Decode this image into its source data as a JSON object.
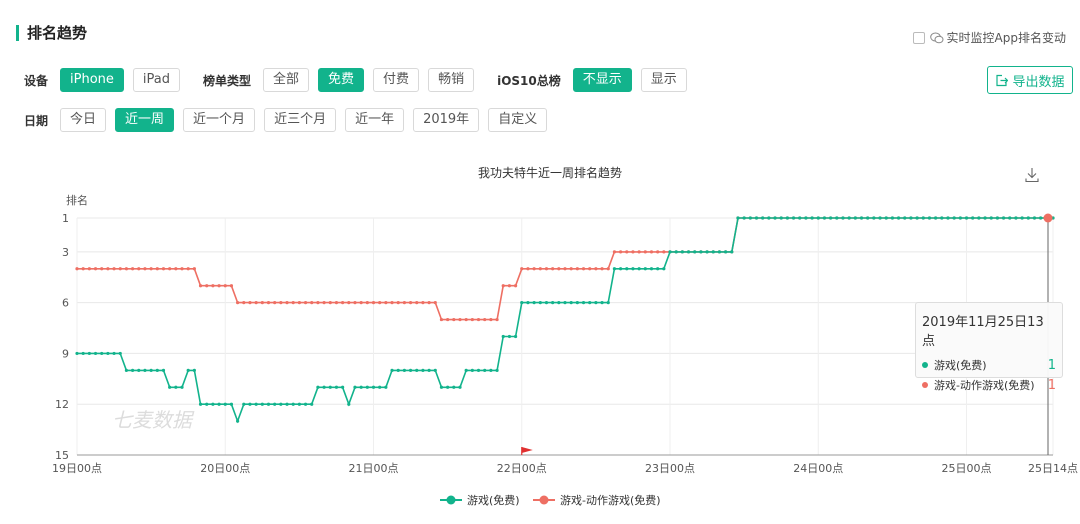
{
  "header": {
    "title": "排名趋势",
    "monitor_label": "实时监控App排名变动",
    "export_label": "导出数据"
  },
  "filters": {
    "device": {
      "label": "设备",
      "options": [
        "iPhone",
        "iPad"
      ],
      "selected": "iPhone"
    },
    "list_type": {
      "label": "榜单类型",
      "options": [
        "全部",
        "免费",
        "付费",
        "畅销"
      ],
      "selected": "免费"
    },
    "ios10": {
      "label": "iOS10总榜",
      "options": [
        "不显示",
        "显示"
      ],
      "selected": "不显示"
    },
    "date": {
      "label": "日期",
      "options": [
        "今日",
        "近一周",
        "近一个月",
        "近三个月",
        "近一年",
        "2019年",
        "自定义"
      ],
      "selected": "近一周"
    }
  },
  "colors": {
    "accent": "#12b38c",
    "series_green": "#12b38c",
    "series_red": "#ee6f63"
  },
  "icons": {
    "monitor": "wechat-icon",
    "export": "export-icon",
    "download": "download-icon",
    "marker": "flag-icon"
  },
  "watermark": "七麦数据",
  "tooltip": {
    "title": "2019年11月25日13点",
    "rows": [
      {
        "name": "游戏(免费)",
        "value": "1"
      },
      {
        "name": "游戏-动作游戏(免费)",
        "value": "1"
      }
    ]
  },
  "chart_data": {
    "type": "line",
    "title": "我功夫特牛近一周排名趋势",
    "ylabel": "排名",
    "y_inverted": true,
    "ylim": [
      1,
      15
    ],
    "yticks": [
      1,
      3,
      6,
      9,
      12,
      15
    ],
    "x_start_label": "19日00点",
    "x_ticks": [
      "19日00点",
      "20日00点",
      "21日00点",
      "22日00点",
      "23日00点",
      "24日00点",
      "25日00点",
      "25日14点"
    ],
    "x_hours_range": [
      0,
      158
    ],
    "legend": "bottom-center",
    "grid": true,
    "marker_label_x": "22日00点",
    "series": [
      {
        "name": "游戏(免费)",
        "points": [
          [
            0,
            9
          ],
          [
            7,
            9
          ],
          [
            8,
            10
          ],
          [
            14,
            10
          ],
          [
            15,
            11
          ],
          [
            17,
            11
          ],
          [
            18,
            10
          ],
          [
            19,
            10
          ],
          [
            20,
            12
          ],
          [
            25,
            12
          ],
          [
            26,
            13
          ],
          [
            27,
            12
          ],
          [
            38,
            12
          ],
          [
            39,
            11
          ],
          [
            43,
            11
          ],
          [
            44,
            12
          ],
          [
            45,
            11
          ],
          [
            50,
            11
          ],
          [
            51,
            10
          ],
          [
            58,
            10
          ],
          [
            59,
            11
          ],
          [
            62,
            11
          ],
          [
            63,
            10
          ],
          [
            68,
            10
          ],
          [
            69,
            8
          ],
          [
            71,
            8
          ],
          [
            72,
            6
          ],
          [
            86,
            6
          ],
          [
            87,
            4
          ],
          [
            95,
            4
          ],
          [
            96,
            3
          ],
          [
            106,
            3
          ],
          [
            107,
            1
          ],
          [
            158,
            1
          ]
        ]
      },
      {
        "name": "游戏-动作游戏(免费)",
        "points": [
          [
            0,
            4
          ],
          [
            19,
            4
          ],
          [
            20,
            5
          ],
          [
            25,
            5
          ],
          [
            26,
            6
          ],
          [
            58,
            6
          ],
          [
            59,
            7
          ],
          [
            68,
            7
          ],
          [
            69,
            5
          ],
          [
            71,
            5
          ],
          [
            72,
            4
          ],
          [
            86,
            4
          ],
          [
            87,
            3
          ],
          [
            106,
            3
          ],
          [
            107,
            1
          ],
          [
            158,
            1
          ]
        ]
      }
    ]
  }
}
